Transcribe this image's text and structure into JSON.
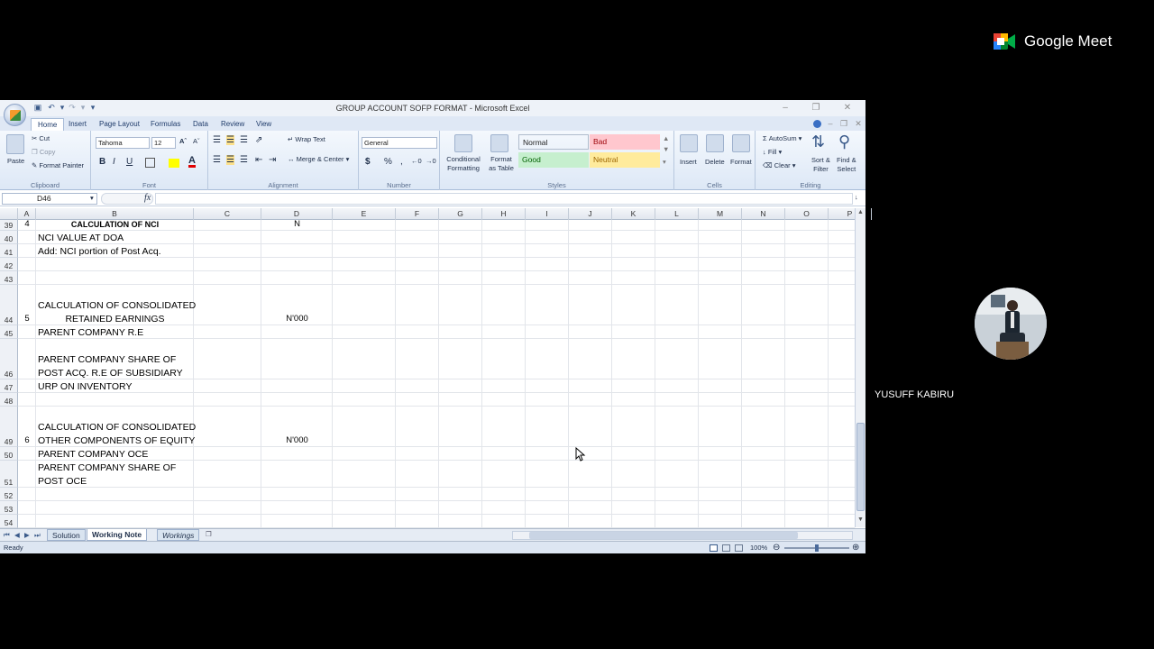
{
  "meet": {
    "logo_text": "Google Meet",
    "participant_name": "YUSUFF KABIRU"
  },
  "excel": {
    "title": "GROUP ACCOUNT SOFP FORMAT - Microsoft Excel",
    "tabs": [
      "Home",
      "Insert",
      "Page Layout",
      "Formulas",
      "Data",
      "Review",
      "View"
    ],
    "ribbon": {
      "paste": "Paste",
      "cut": "Cut",
      "copy": "Copy",
      "format_painter": "Format Painter",
      "font_name": "Tahoma",
      "font_size": "12",
      "bold": "B",
      "italic": "I",
      "underline": "U",
      "wrap_text": "Wrap Text",
      "merge_center": "Merge & Center",
      "number_format": "General",
      "currency": "$",
      "percent": "%",
      "comma": ",",
      "conditional_formatting": [
        "Conditional",
        "Formatting"
      ],
      "format_as_table": [
        "Format",
        "as Table"
      ],
      "styles": [
        {
          "label": "Normal",
          "bg": "#ffffff",
          "fg": "#000000"
        },
        {
          "label": "Bad",
          "bg": "#ffc7ce",
          "fg": "#9c0006"
        },
        {
          "label": "Good",
          "bg": "#c6efce",
          "fg": "#006100"
        },
        {
          "label": "Neutral",
          "bg": "#ffeb9c",
          "fg": "#9c6500"
        }
      ],
      "insert": "Insert",
      "delete": "Delete",
      "format": "Format",
      "autosum": "AutoSum",
      "fill": "Fill",
      "clear": "Clear",
      "sort_filter": [
        "Sort &",
        "Filter"
      ],
      "find_select": [
        "Find &",
        "Select"
      ],
      "groups": [
        "Clipboard",
        "Font",
        "Alignment",
        "Number",
        "Styles",
        "Cells",
        "Editing"
      ]
    },
    "name_box": "D46",
    "fx": "fx",
    "columns": [
      "A",
      "B",
      "C",
      "D",
      "E",
      "F",
      "G",
      "H",
      "I",
      "J",
      "K",
      "L",
      "M",
      "N",
      "O",
      "P"
    ],
    "rows": [
      {
        "n": "39",
        "a": "4",
        "b": "CALCULATION OF NCI",
        "d": "N",
        "bold": true
      },
      {
        "n": "40",
        "b": "NCI VALUE AT DOA"
      },
      {
        "n": "41",
        "b": "Add: NCI portion of Post Acq."
      },
      {
        "n": "42"
      },
      {
        "n": "43"
      },
      {
        "n": "44",
        "a": "5",
        "b1": "CALCULATION OF CONSOLIDATED",
        "b2": "RETAINED EARNINGS",
        "d": "N'000"
      },
      {
        "n": "45",
        "b": "PARENT COMPANY R.E"
      },
      {
        "n": "46",
        "b1": "PARENT COMPANY SHARE OF",
        "b2": "POST ACQ. R.E OF SUBSIDIARY"
      },
      {
        "n": "47",
        "b": "URP ON INVENTORY"
      },
      {
        "n": "48"
      },
      {
        "n": "49",
        "a": "6",
        "b1": "CALCULATION OF CONSOLIDATED",
        "b2": "OTHER COMPONENTS OF EQUITY",
        "d": "N'000"
      },
      {
        "n": "50",
        "b": "PARENT COMPANY OCE"
      },
      {
        "n": "51",
        "b1": "PARENT COMPANY SHARE OF",
        "b2": "POST OCE"
      },
      {
        "n": "52"
      },
      {
        "n": "53"
      },
      {
        "n": "54"
      }
    ],
    "sheets": [
      "Solution",
      "Working Note",
      "Workings"
    ],
    "active_sheet": "Working Note",
    "status": "Ready",
    "zoom": "100%"
  }
}
